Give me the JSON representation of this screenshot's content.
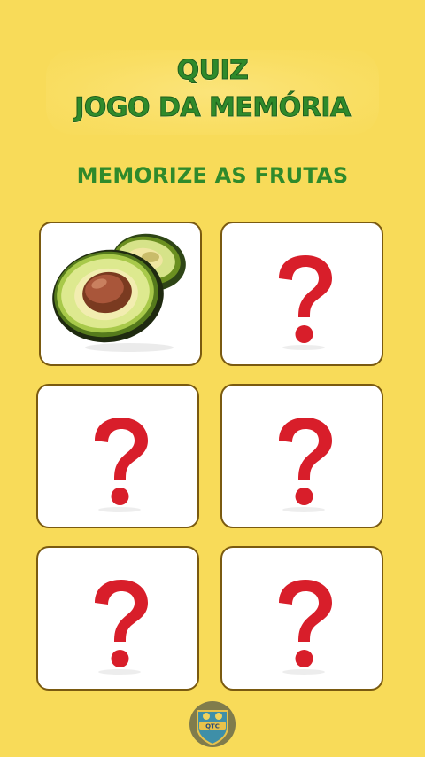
{
  "header": {
    "line1": "QUIZ",
    "line2": "JOGO DA MEMÓRIA"
  },
  "instruction": "MEMORIZE AS FRUTAS",
  "cards": [
    {
      "state": "revealed",
      "fruit": "avocado"
    },
    {
      "state": "hidden",
      "icon": "question-mark-icon"
    },
    {
      "state": "hidden",
      "icon": "question-mark-icon"
    },
    {
      "state": "hidden",
      "icon": "question-mark-icon"
    },
    {
      "state": "hidden",
      "icon": "question-mark-icon"
    },
    {
      "state": "hidden",
      "icon": "question-mark-icon"
    }
  ],
  "logo": {
    "text": "QTC",
    "icon": "shield-badge-icon"
  },
  "colors": {
    "background": "#F8DB59",
    "title_green": "#2F8A2B",
    "question_red": "#D81E2A",
    "card_border": "#7A5A10"
  }
}
